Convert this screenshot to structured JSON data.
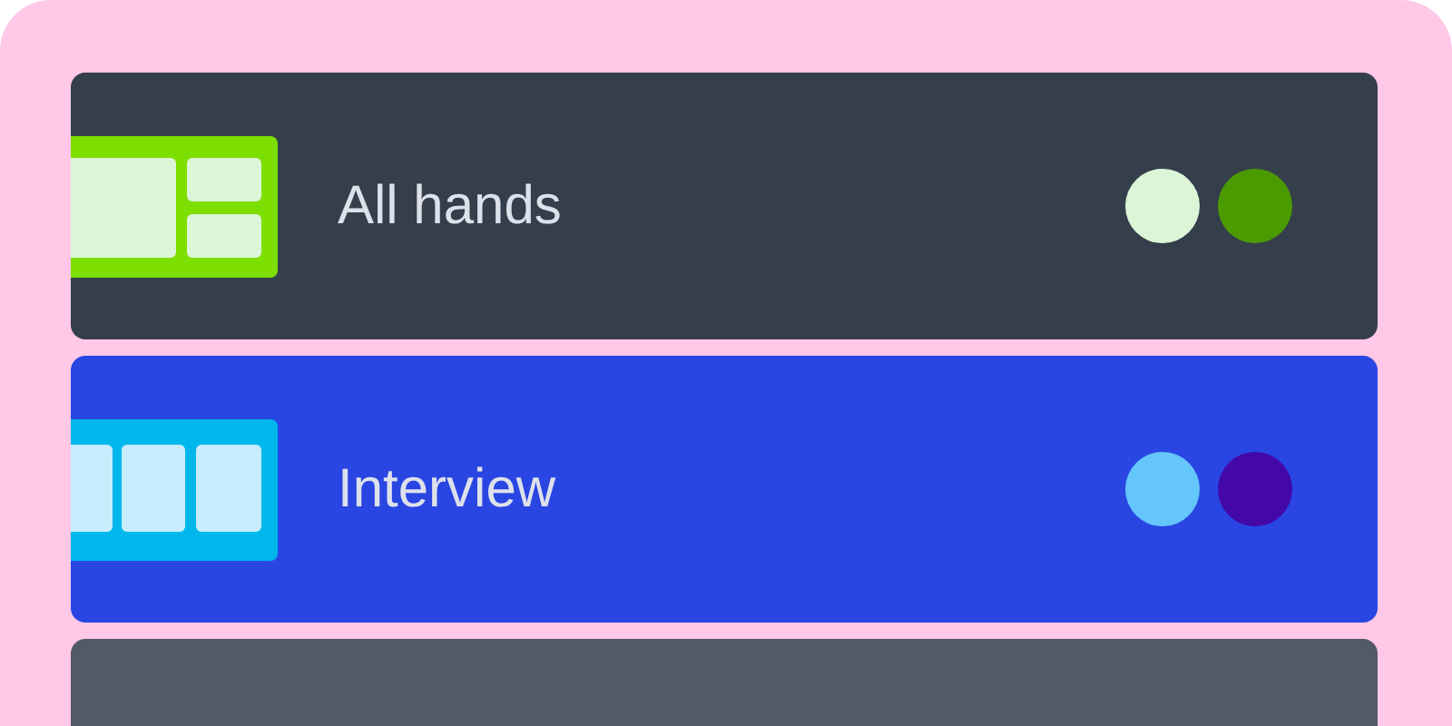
{
  "cards": [
    {
      "title": "All hands",
      "color": "#353e4b",
      "icon": {
        "kind": "split",
        "color": "#7ddf00",
        "panes": [
          {
            "color": "#dcf5d7"
          },
          {
            "color": "#dcf5d7"
          },
          {
            "color": "#dcf5d7"
          }
        ]
      },
      "swatches": [
        {
          "color": "#dcf5d7"
        },
        {
          "color": "#4b9b00"
        }
      ]
    },
    {
      "title": "Interview",
      "color": "#2946e3",
      "icon": {
        "kind": "columns",
        "color": "#00b8ec",
        "panes": [
          {
            "color": "#c8edfc"
          },
          {
            "color": "#c8edfc"
          },
          {
            "color": "#c8edfc"
          }
        ]
      },
      "swatches": [
        {
          "color": "#64c6fa"
        },
        {
          "color": "#4408a8"
        }
      ]
    },
    {
      "color": "#525a67"
    }
  ]
}
